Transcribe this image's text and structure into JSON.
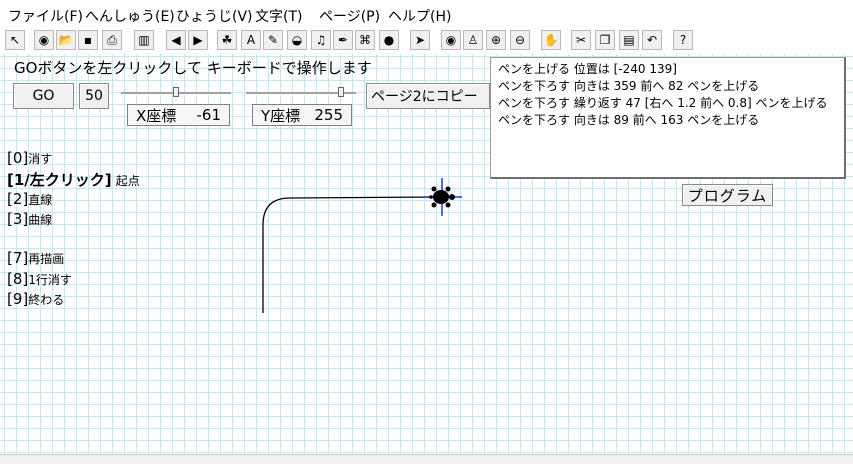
{
  "menu": [
    {
      "label": "ファイル(F)"
    },
    {
      "label": "へんしゅう(E)"
    },
    {
      "label": "ひょうじ(V)"
    },
    {
      "label": "文字(T)"
    },
    {
      "label": "ページ(P)"
    },
    {
      "label": "ヘルプ(H)"
    }
  ],
  "toolbar": {
    "buttons": [
      {
        "icon": "pointer-reset-icon",
        "glyph": "↖"
      },
      {
        "icon": "globe-icon",
        "glyph": "◉"
      },
      {
        "icon": "open-folder-icon",
        "glyph": "📂"
      },
      {
        "icon": "save-icon",
        "glyph": "▪"
      },
      {
        "icon": "print-icon",
        "glyph": "⎙"
      },
      {
        "icon": "panel-icon",
        "glyph": "▥"
      },
      {
        "icon": "arrow-left-icon",
        "glyph": "◀"
      },
      {
        "icon": "arrow-right-icon",
        "glyph": "▶"
      },
      {
        "icon": "turtle-icon",
        "glyph": "☘"
      },
      {
        "icon": "text-a-icon",
        "glyph": "A"
      },
      {
        "icon": "draw-icon",
        "glyph": "✎"
      },
      {
        "icon": "eye-lips-icon",
        "glyph": "◒"
      },
      {
        "icon": "music-note-icon",
        "glyph": "♫"
      },
      {
        "icon": "pen-icon",
        "glyph": "✒"
      },
      {
        "icon": "projector-icon",
        "glyph": "⌘"
      },
      {
        "icon": "world-icon",
        "glyph": "●"
      },
      {
        "icon": "cursor-icon",
        "glyph": "➤"
      },
      {
        "icon": "eye-icon",
        "glyph": "◉"
      },
      {
        "icon": "stamp-icon",
        "glyph": "♙"
      },
      {
        "icon": "zoom-in-icon",
        "glyph": "⊕"
      },
      {
        "icon": "zoom-out-icon",
        "glyph": "⊖"
      },
      {
        "icon": "stop-hand-icon",
        "glyph": "✋"
      },
      {
        "icon": "scissors-icon",
        "glyph": "✂"
      },
      {
        "icon": "copy-icon",
        "glyph": "❐"
      },
      {
        "icon": "paste-icon",
        "glyph": "▤"
      },
      {
        "icon": "undo-icon",
        "glyph": "↶"
      },
      {
        "icon": "help-icon",
        "glyph": "?"
      }
    ]
  },
  "controls": {
    "hint": "GOボタンを左クリックして キーボードで操作します",
    "go_label": "GO",
    "speed_value": "50",
    "x_label": "X座標",
    "x_value": "-61",
    "y_label": "Y座標",
    "y_value": "255",
    "copy_page2_label": "ページ2にコピー",
    "program_button_label": "プログラム"
  },
  "program_lines": [
    "ペンを上げる 位置は [-240 139]",
    "ペンを下ろす 向きは 359 前へ 82 ペンを上げる",
    "ペンを下ろす 繰り返す 47 [右へ 1.2 前へ 0.8] ペンを上げる",
    "ペンを下ろす 向きは 89 前へ 163 ペンを上げる"
  ],
  "side_menu": [
    {
      "key": "[0]",
      "desc": "消す",
      "bold": false
    },
    {
      "key": "[1/左クリック]",
      "desc": "起点",
      "bold": true
    },
    {
      "key": "[2]",
      "desc": "直線",
      "bold": false
    },
    {
      "key": "[3]",
      "desc": "曲線",
      "bold": false
    },
    {
      "key": "[7]",
      "desc": "再描画",
      "bold": false
    },
    {
      "key": "[8]",
      "desc": "1行消す",
      "bold": false
    },
    {
      "key": "[9]",
      "desc": "終わる",
      "bold": false
    }
  ],
  "colors": {
    "grid": "#bfeaf3",
    "button_face": "#f0f0f0",
    "turtle": "#000000",
    "crosshair": "#1a3cc8"
  }
}
